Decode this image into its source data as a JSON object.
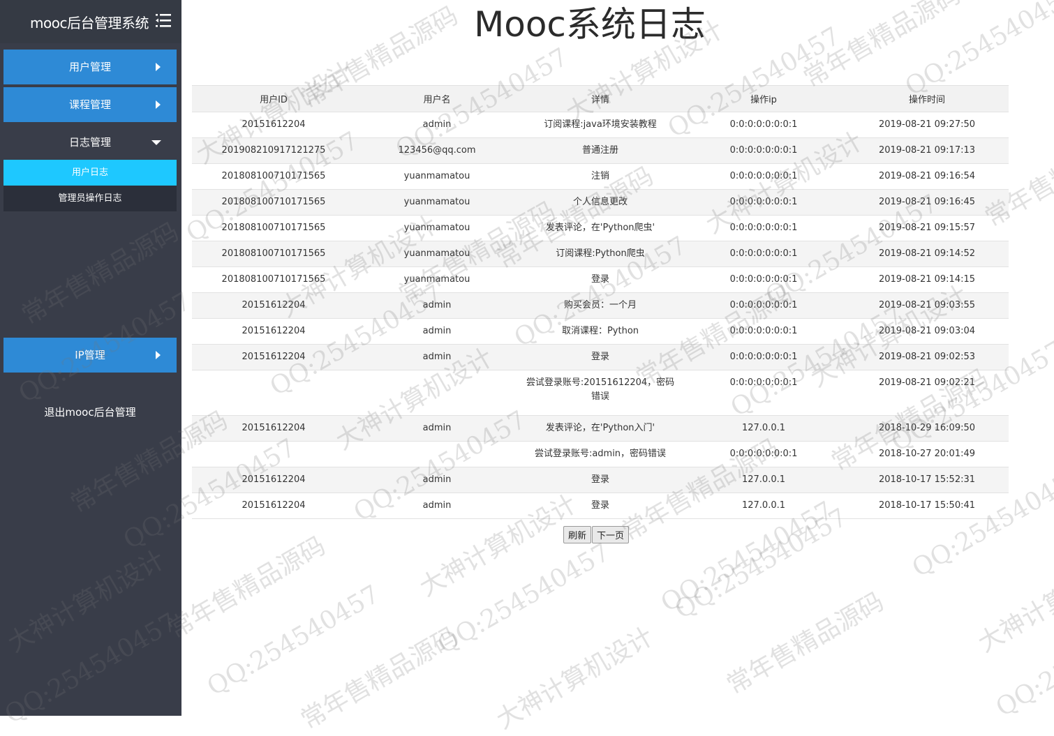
{
  "sidebar": {
    "brand_title": "mooc后台管理系统",
    "menu_icon": "hamburger-icon",
    "nav": {
      "user_mgmt": "用户管理",
      "course_mgmt": "课程管理",
      "log_mgmt": "日志管理",
      "ip_mgmt": "IP管理"
    },
    "log_submenu": {
      "user_log": "用户日志",
      "admin_log": "管理员操作日志"
    },
    "logout": "退出mooc后台管理"
  },
  "main": {
    "title": "Mooc系统日志"
  },
  "table": {
    "columns": [
      "用户ID",
      "用户名",
      "详情",
      "操作ip",
      "操作时间"
    ],
    "rows": [
      [
        "20151612204",
        "admin",
        "订阅课程:java环境安装教程",
        "0:0:0:0:0:0:0:1",
        "2019-08-21 09:27:50"
      ],
      [
        "20190821091712127​5",
        "123456@qq.com",
        "普通注册",
        "0:0:0:0:0:0:0:1",
        "2019-08-21 09:17:13"
      ],
      [
        "201808100710171565",
        "yuanmamatou",
        "注销",
        "0:0:0:0:0:0:0:1",
        "2019-08-21 09:16:54"
      ],
      [
        "201808100710171565",
        "yuanmamatou",
        "个人信息更改",
        "0:0:0:0:0:0:0:1",
        "2019-08-21 09:16:45"
      ],
      [
        "201808100710171565",
        "yuanmamatou",
        "发表评论，在'Python爬虫'",
        "0:0:0:0:0:0:0:1",
        "2019-08-21 09:15:57"
      ],
      [
        "201808100710171565",
        "yuanmamatou",
        "订阅课程:Python爬虫",
        "0:0:0:0:0:0:0:1",
        "2019-08-21 09:14:52"
      ],
      [
        "201808100710171565",
        "yuanmamatou",
        "登录",
        "0:0:0:0:0:0:0:1",
        "2019-08-21 09:14:15"
      ],
      [
        "20151612204",
        "admin",
        "购买会员：一个月",
        "0:0:0:0:0:0:0:1",
        "2019-08-21 09:03:55"
      ],
      [
        "20151612204",
        "admin",
        "取消课程：Python",
        "0:0:0:0:0:0:0:1",
        "2019-08-21 09:03:04"
      ],
      [
        "20151612204",
        "admin",
        "登录",
        "0:0:0:0:0:0:0:1",
        "2019-08-21 09:02:53"
      ],
      [
        "",
        "",
        "尝试登录账号:20151612204，密码错误",
        "0:0:0:0:0:0:0:1",
        "2019-08-21 09:02:21"
      ],
      [
        "20151612204",
        "admin",
        "发表评论，在'Python入门'",
        "127.0.0.1",
        "2018-10-29 16:09:50"
      ],
      [
        "",
        "",
        "尝试登录账号:admin，密码错误",
        "0:0:0:0:0:0:0:1",
        "2018-10-27 20:01:49"
      ],
      [
        "20151612204",
        "admin",
        "登录",
        "127.0.0.1",
        "2018-10-17 15:52:31"
      ],
      [
        "20151612204",
        "admin",
        "登录",
        "127.0.0.1",
        "2018-10-17 15:50:41"
      ]
    ]
  },
  "pager": {
    "refresh": "刷新",
    "next": "下一页"
  },
  "watermark": {
    "texts": [
      "QQ:25454045​7",
      "常年售精品源码",
      "大神计算机设计"
    ]
  },
  "colors": {
    "sidebar_bg": "#393d49",
    "nav_blue": "#2e8ad6",
    "active_cyan": "#1ec8ff"
  }
}
